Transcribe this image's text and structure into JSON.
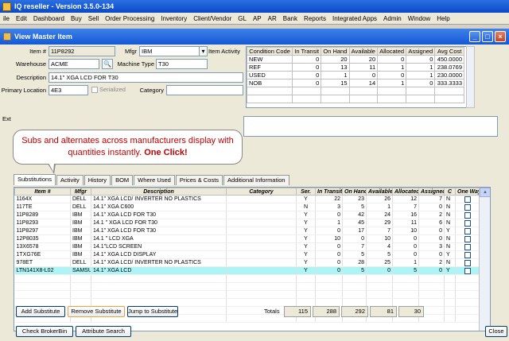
{
  "app": {
    "title": "IQ reseller - Version 3.5.0-134"
  },
  "menu": [
    "ile",
    "Edit",
    "Dashboard",
    "Buy",
    "Sell",
    "Order Processing",
    "Inventory",
    "Client/Vendor",
    "GL",
    "AP",
    "AR",
    "Bank",
    "Reports",
    "Integrated Apps",
    "Admin",
    "Window",
    "Help"
  ],
  "window": {
    "title": "View Master Item",
    "min": "_",
    "max": "□",
    "close": "×"
  },
  "form": {
    "item_label": "Item #",
    "item_value": "11P8292",
    "mfgr_label": "Mfgr",
    "mfgr_value": "IBM",
    "item_activity_label": "Item Activity",
    "warehouse_label": "Warehouse",
    "warehouse_value": "ACME",
    "machine_type_label": "Machine Type",
    "machine_type_value": "T30",
    "description_label": "Description",
    "description_value": "14.1\" XGA LCD FOR T30",
    "primary_location_label": "Primary Location",
    "primary_location_value": "4E3",
    "serialized_label": "Serialized",
    "category_label": "Category",
    "category_value": "",
    "ext_label": "Ext"
  },
  "condition_table": {
    "headers": [
      "Condition Code",
      "In Transit",
      "On Hand",
      "Available",
      "Allocated",
      "Assigned",
      "Avg Cost"
    ],
    "rows": [
      [
        "NEW",
        "0",
        "20",
        "20",
        "0",
        "0",
        "450.0000"
      ],
      [
        "REF",
        "0",
        "13",
        "11",
        "1",
        "1",
        "238.0769"
      ],
      [
        "USED",
        "0",
        "1",
        "0",
        "0",
        "1",
        "230.0000"
      ],
      [
        "NOB",
        "0",
        "15",
        "14",
        "1",
        "0",
        "333.3333"
      ]
    ]
  },
  "callout": {
    "text": "Subs and alternates across manufacturers display with quantities instantly.",
    "emph": "One Click!"
  },
  "tabs": [
    "Substitutions",
    "Activity",
    "History",
    "BOM",
    "Where Used",
    "Prices & Costs",
    "Additional Information"
  ],
  "subs": {
    "headers": [
      "Item #",
      "Mfgr",
      "Description",
      "Category",
      "Ser.",
      "In Transit",
      "On Hand",
      "Available",
      "Allocated",
      "Assigned",
      "C",
      "One Way"
    ],
    "rows": [
      [
        "1164X",
        "DELL",
        "14.1\" XGA LCD/ INVERTER NO PLASTICS",
        "",
        "Y",
        "22",
        "23",
        "26",
        "12",
        "7",
        "N"
      ],
      [
        "117TE",
        "DELL",
        "14.1\" XGA C600",
        "",
        "N",
        "3",
        "5",
        "1",
        "7",
        "0",
        "N"
      ],
      [
        "11P8289",
        "IBM",
        "14.1\" XGA LCD FOR T30",
        "",
        "Y",
        "0",
        "42",
        "24",
        "16",
        "2",
        "N"
      ],
      [
        "11P8293",
        "IBM",
        "14.1 \" XGA LCD FOR T30",
        "",
        "Y",
        "1",
        "45",
        "29",
        "11",
        "6",
        "N"
      ],
      [
        "11P8297",
        "IBM",
        "14.1\" XGA LCD FOR T30",
        "",
        "Y",
        "0",
        "17",
        "7",
        "10",
        "0",
        "Y"
      ],
      [
        "12P8035",
        "IBM",
        "14.1 \" LCD XGA",
        "",
        "Y",
        "10",
        "0",
        "10",
        "0",
        "0",
        "N"
      ],
      [
        "13X6578",
        "IBM",
        "14.1\"LCD SCREEN",
        "",
        "Y",
        "0",
        "7",
        "4",
        "0",
        "3",
        "N"
      ],
      [
        "1TXG76E",
        "IBM",
        "14.1\" XGA LCD DISPLAY",
        "",
        "Y",
        "0",
        "5",
        "5",
        "0",
        "0",
        "Y"
      ],
      [
        "978ET",
        "DELL",
        "14.1\" XGA LCD/ INVERTER NO PLASTICS",
        "",
        "Y",
        "0",
        "28",
        "25",
        "1",
        "2",
        "N"
      ],
      [
        "LTN141X8-L02",
        "SAMSUN",
        "14.1\" XGA LCD",
        "",
        "Y",
        "0",
        "5",
        "0",
        "5",
        "0",
        "Y"
      ]
    ]
  },
  "totals": {
    "label": "Totals",
    "in_transit": "115",
    "on_hand": "288",
    "available": "292",
    "allocated": "81",
    "assigned": "30"
  },
  "buttons": {
    "add": "Add Substitute",
    "remove": "Remove Substitute",
    "jump": "Jump to Substitute",
    "broker": "Check BrokerBin",
    "attr": "Attribute Search",
    "close": "Close"
  }
}
